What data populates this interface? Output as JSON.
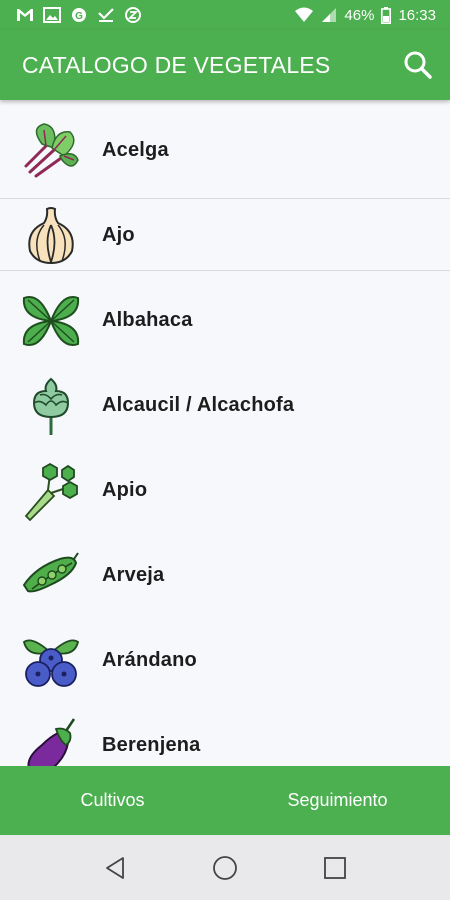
{
  "status_bar": {
    "battery": "46%",
    "time": "16:33",
    "left_icons": [
      "gmail-icon",
      "photo-icon",
      "cast-icon",
      "download-done-icon",
      "sync-icon"
    ]
  },
  "app_bar": {
    "title": "CATALOGO DE VEGETALES"
  },
  "vegetables": [
    {
      "name": "Acelga",
      "icon": "chard-icon"
    },
    {
      "name": "Ajo",
      "icon": "garlic-icon"
    },
    {
      "name": "Albahaca",
      "icon": "basil-icon"
    },
    {
      "name": "Alcaucil / Alcachofa",
      "icon": "artichoke-icon"
    },
    {
      "name": "Apio",
      "icon": "celery-icon"
    },
    {
      "name": "Arveja",
      "icon": "pea-icon"
    },
    {
      "name": "Arándano",
      "icon": "blueberry-icon"
    },
    {
      "name": "Berenjena",
      "icon": "eggplant-icon"
    }
  ],
  "bottom_nav": {
    "tabs": [
      "Cultivos",
      "Seguimiento"
    ]
  },
  "colors": {
    "primary": "#4caf50",
    "background": "#f7f8fc"
  }
}
